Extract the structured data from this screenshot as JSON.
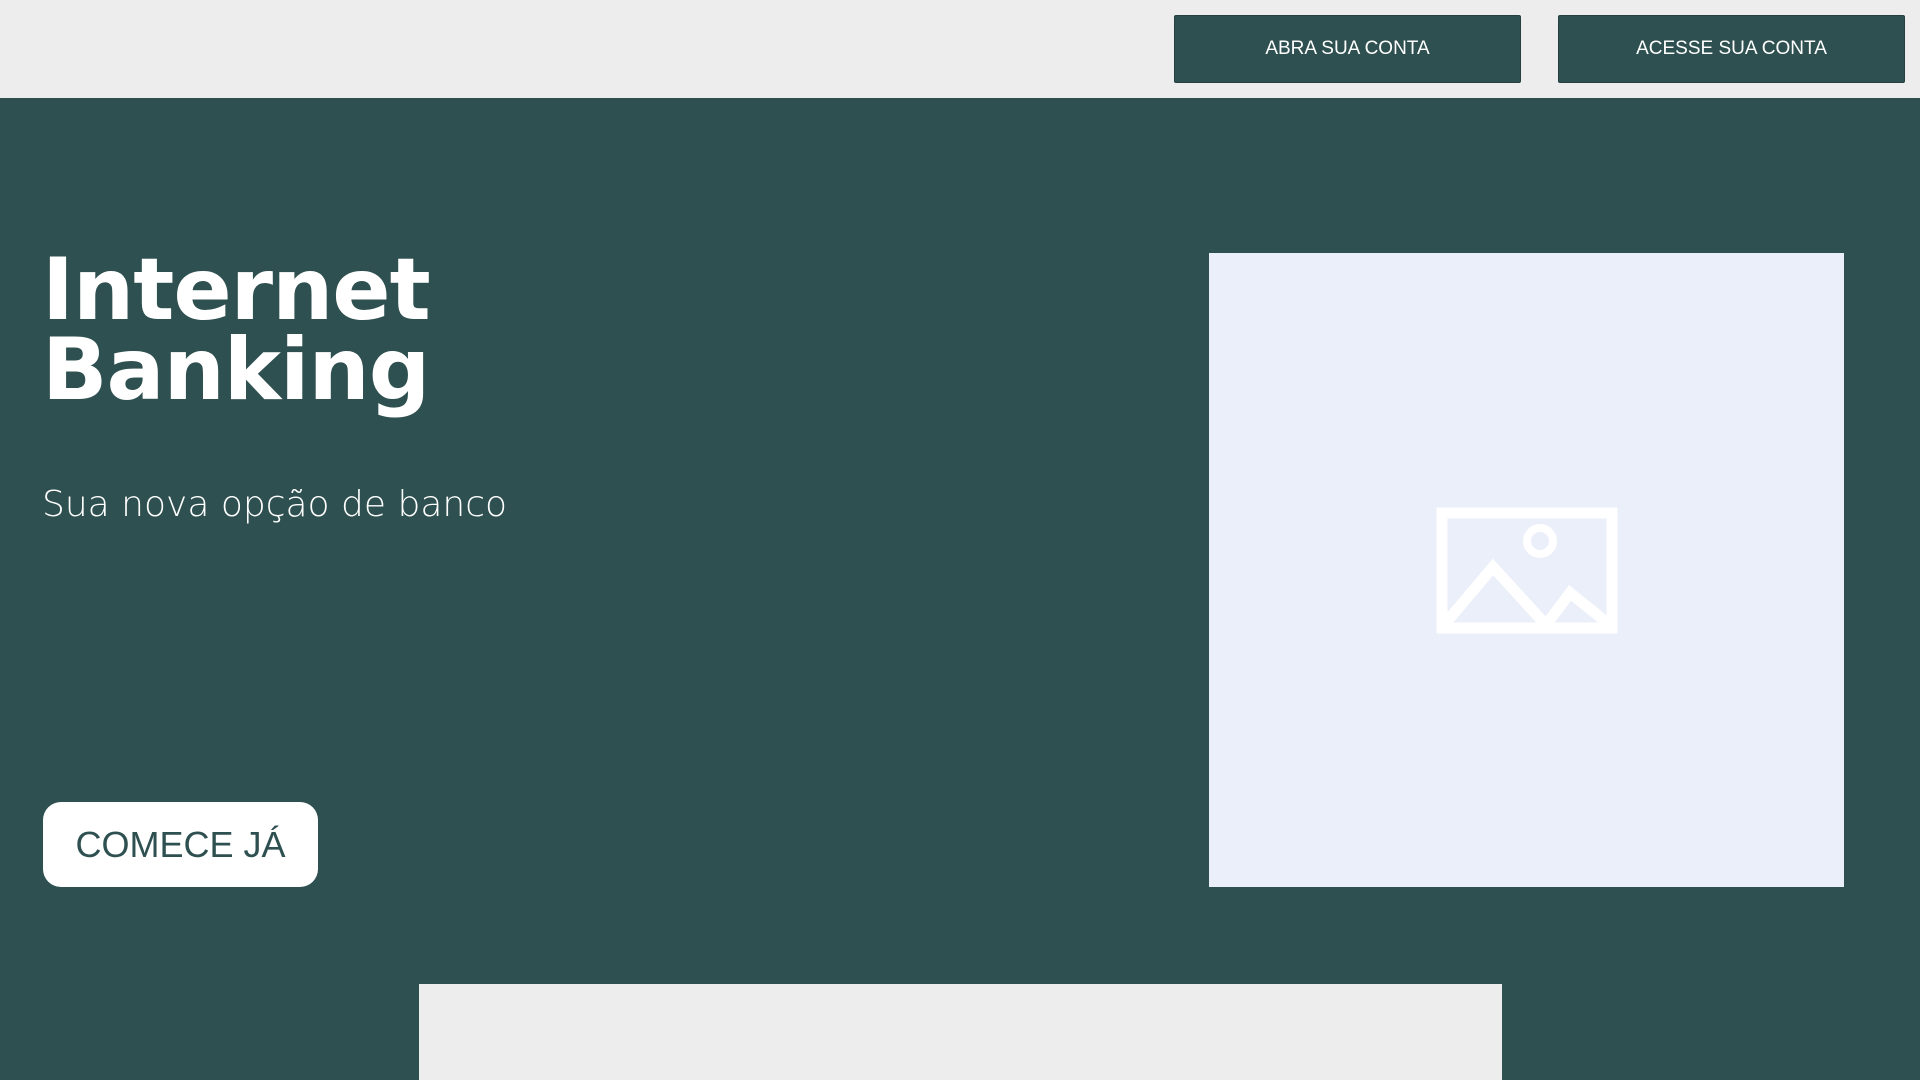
{
  "header": {
    "open_account_label": "ABRA SUA CONTA",
    "access_account_label": "ACESSE SUA CONTA"
  },
  "hero": {
    "title_line1": "Internet",
    "title_line2": "Banking",
    "subtitle": "Sua nova opção de banco",
    "cta_label": "COMECE JÁ",
    "image_icon": "image-placeholder-icon"
  },
  "colors": {
    "primary": "#2f5050",
    "header_bg": "#ededed",
    "image_bg": "#ebeffa",
    "text_light": "#ffffff"
  }
}
